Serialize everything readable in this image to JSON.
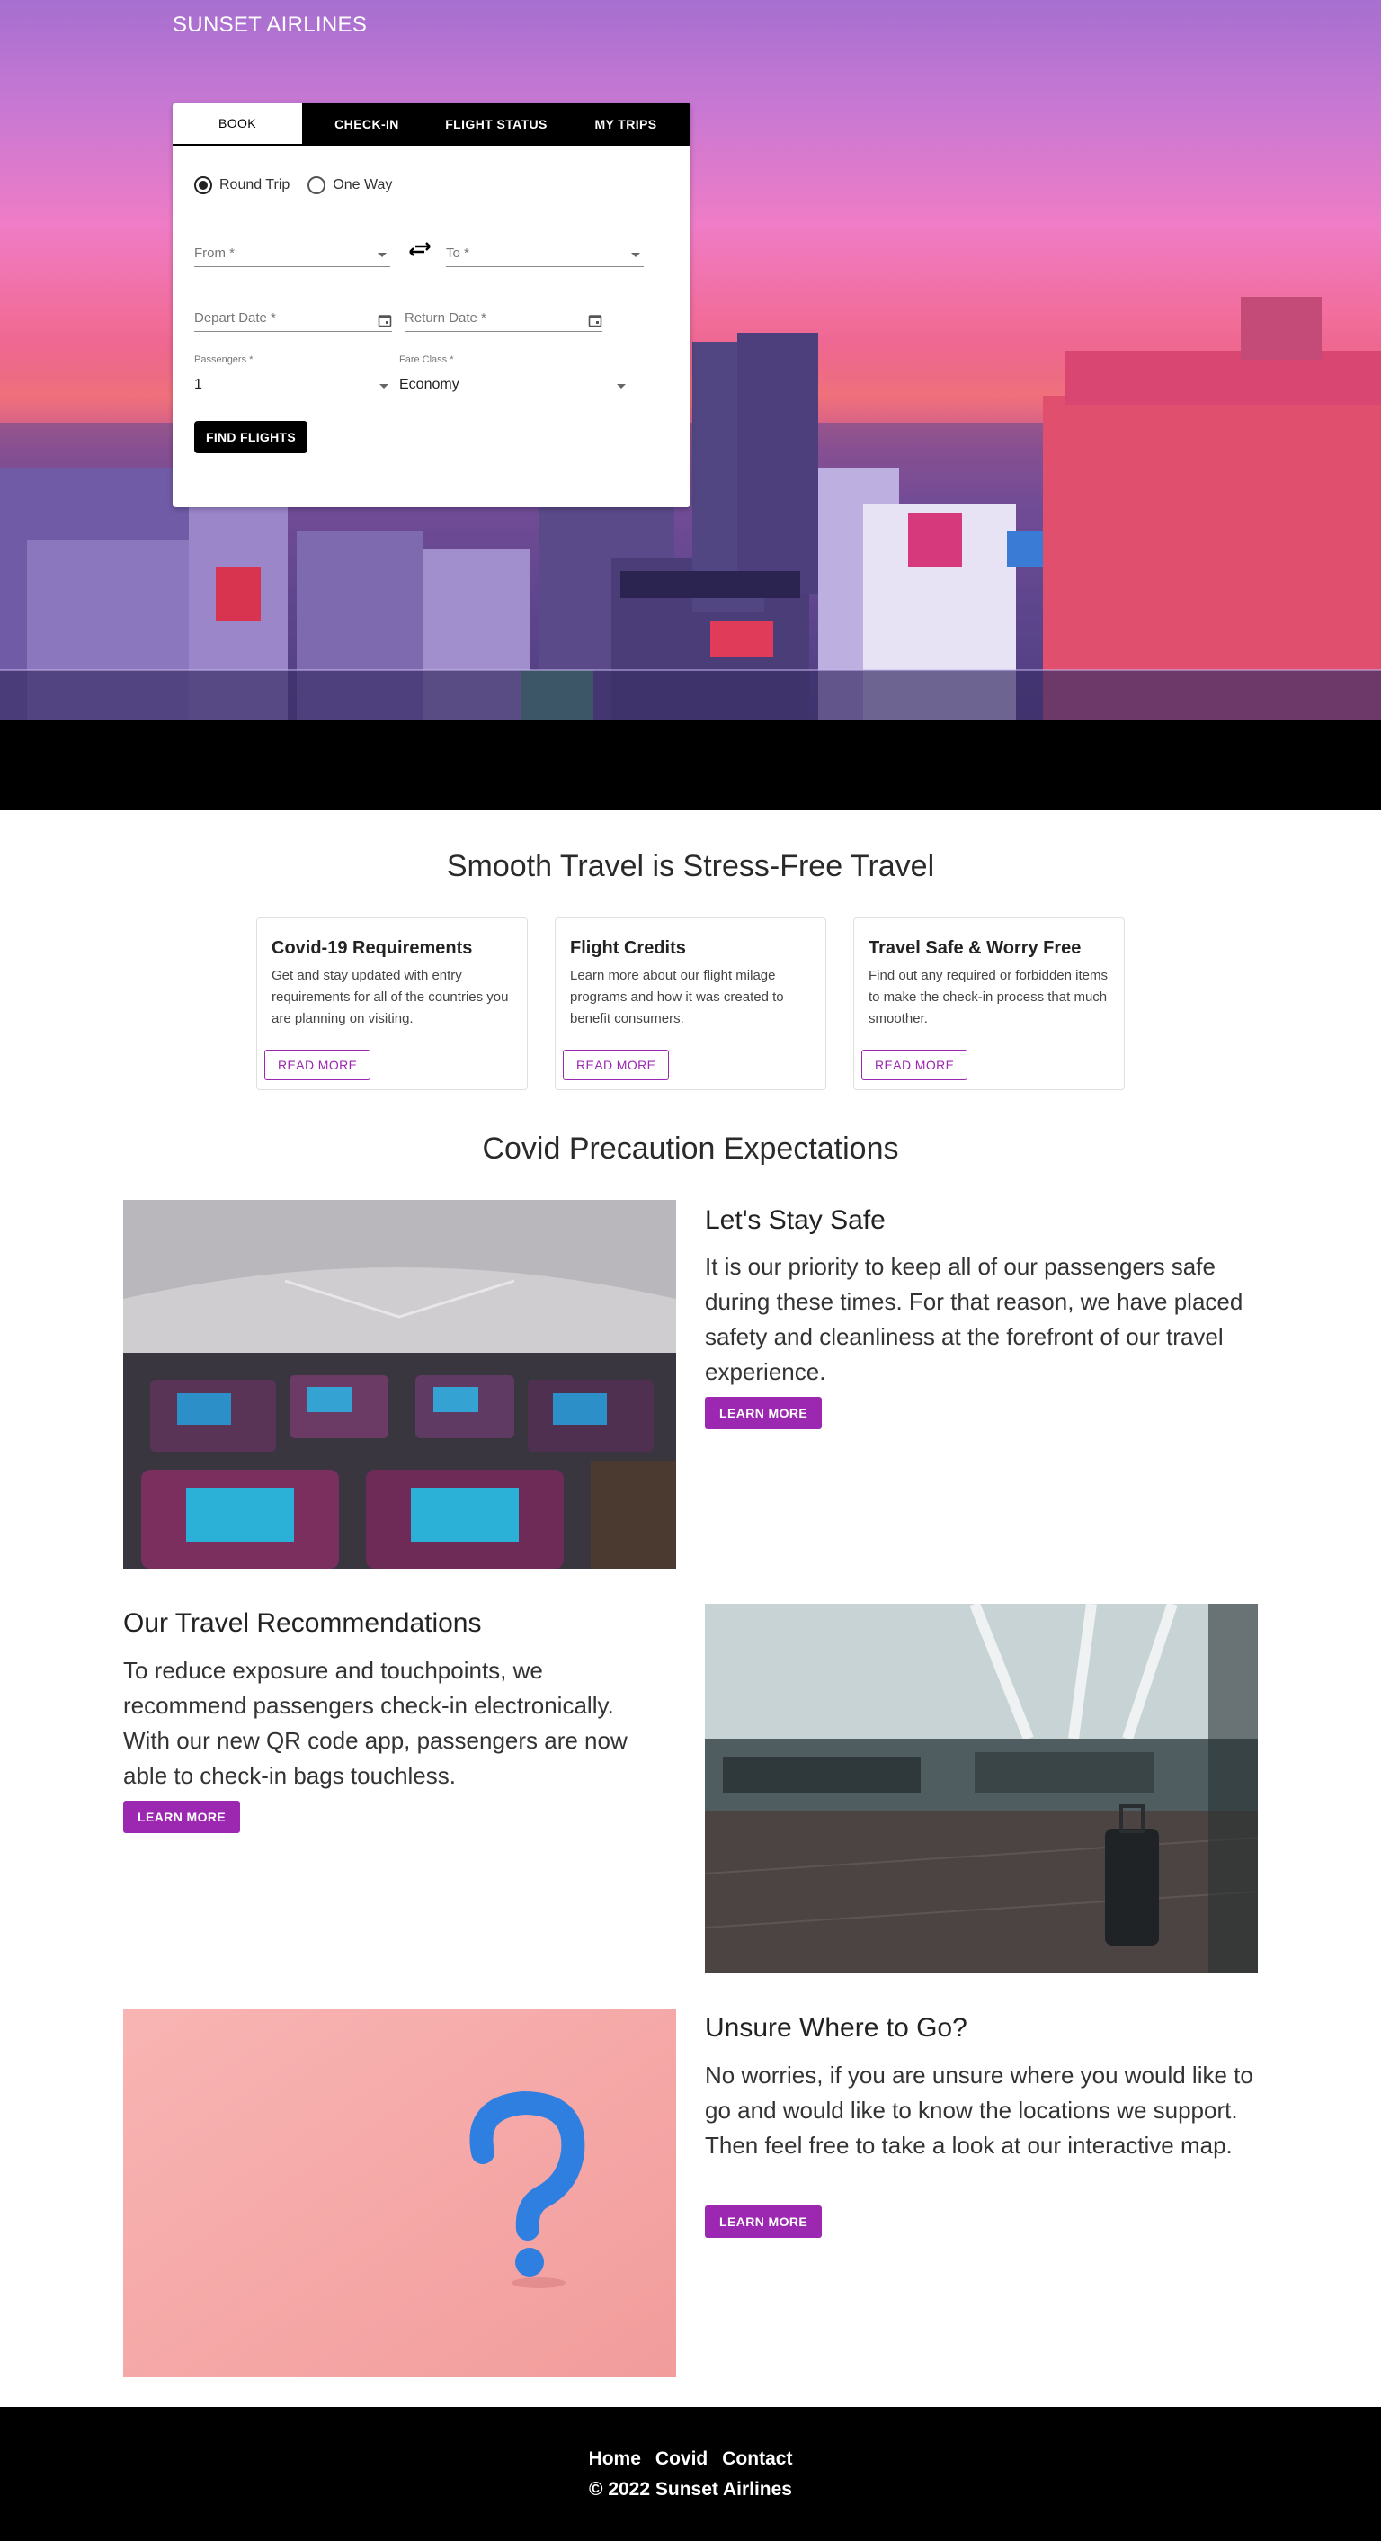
{
  "brand": "SUNSET AIRLINES",
  "booking": {
    "tabs": [
      "BOOK",
      "CHECK-IN",
      "FLIGHT STATUS",
      "MY TRIPS"
    ],
    "trip_types": {
      "round_trip": "Round Trip",
      "one_way": "One Way",
      "selected": "Round Trip"
    },
    "from_placeholder": "From *",
    "to_placeholder": "To *",
    "depart_placeholder": "Depart Date *",
    "return_placeholder": "Return Date *",
    "passengers_label": "Passengers *",
    "passengers_value": "1",
    "fare_class_label": "Fare Class *",
    "fare_class_value": "Economy",
    "submit_label": "FIND FLIGHTS"
  },
  "info": {
    "heading": "Smooth Travel is Stress-Free Travel",
    "cards": [
      {
        "title": "Covid-19 Requirements",
        "text": "Get and stay updated with entry requirements for all of the countries you are planning on visiting.",
        "button": "READ MORE"
      },
      {
        "title": "Flight Credits",
        "text": "Learn more about our flight milage programs and how it was created to benefit consumers.",
        "button": "READ MORE"
      },
      {
        "title": "Travel Safe & Worry Free",
        "text": "Find out any required or forbidden items to make the check-in process that much smoother.",
        "button": "READ MORE"
      }
    ]
  },
  "covid": {
    "heading": "Covid Precaution Expectations",
    "features": [
      {
        "title": "Let's Stay Safe",
        "text": "It is our priority to keep all of our passengers safe during these times. For that reason, we have placed safety and cleanliness at the forefront of our travel experience.",
        "button": "LEARN MORE",
        "image": "airplane-cabin-photo"
      },
      {
        "title": "Our Travel Recommendations",
        "text": "To reduce exposure and touchpoints, we recommend passengers check-in electronically. With our new QR code app, passengers are now able to check-in bags touchless.",
        "button": "LEARN MORE",
        "image": "airport-terminal-photo"
      },
      {
        "title": "Unsure Where to Go?",
        "text": "No worries, if you are unsure where you would like to go and would like to know the locations we support. Then feel free to take a look at our interactive map.",
        "button": "LEARN MORE",
        "image": "question-mark-photo"
      }
    ]
  },
  "footer": {
    "links": [
      "Home",
      "Covid",
      "Contact"
    ],
    "copyright": "©  2022 Sunset Airlines"
  },
  "colors": {
    "accent": "#9c27b0",
    "tab_bar": "#000000",
    "footer": "#000000"
  }
}
